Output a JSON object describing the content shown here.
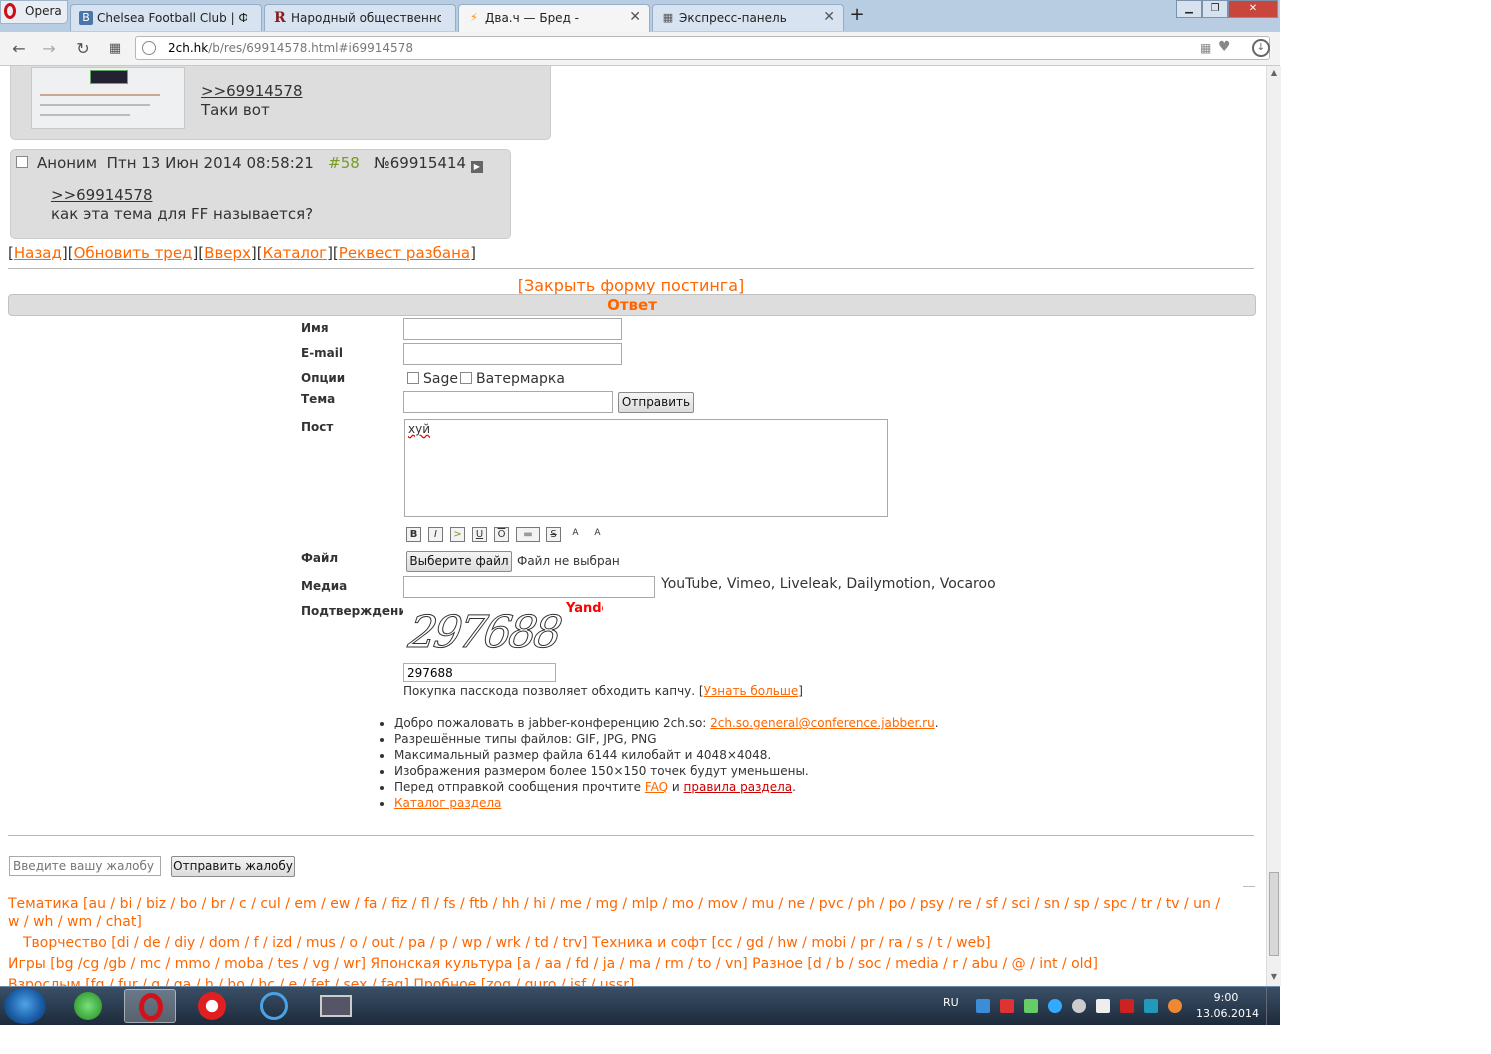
{
  "browser": {
    "opera_label": "Opera",
    "tabs": [
      {
        "title": "Chelsea Football Club | ФК",
        "icon": "B"
      },
      {
        "title": "Народный общественно",
        "icon": "R"
      },
      {
        "title": "Два.ч — Бред -",
        "icon": "⚡"
      },
      {
        "title": "Экспресс-панель",
        "icon": "▦"
      }
    ],
    "new_tab": "+",
    "url_host": "2ch.hk",
    "url_path": "/b/res/69914578.html#i69914578"
  },
  "posts": [
    {
      "reply_link": ">>69914578",
      "text": "Таки вот"
    },
    {
      "author": "Аноним",
      "date": "Птн 13 Июн 2014 08:58:21",
      "index": "#58",
      "number": "№69915414",
      "reply_link": ">>69914578",
      "text": "как эта тема для FF называется?"
    }
  ],
  "thread_nav": {
    "back": "Назад",
    "refresh": "Обновить тред",
    "top": "Вверх",
    "catalog": "Каталог",
    "request": "Реквест разбана"
  },
  "form": {
    "close_label": "[Закрыть форму постинга]",
    "heading": "Ответ",
    "name_label": "Имя",
    "email_label": "E-mail",
    "options_label": "Опции",
    "sage_label": "Sage",
    "watermark_label": "Ватермарка",
    "subject_label": "Тема",
    "send_label": "Отправить",
    "post_label": "Пост",
    "post_value": "хуй",
    "markup_buttons": [
      "B",
      "I",
      ">",
      "U",
      "O",
      "▬",
      "S",
      "A",
      "A"
    ],
    "file_label": "Файл",
    "file_button": "Выберите файл",
    "file_status": "Файл не выбран",
    "media_label": "Медиа",
    "media_hint": "YouTube, Vimeo, Liveleak, Dailymotion, Vocaroo",
    "captcha_label": "Подтверждение",
    "captcha_brand": "Yandex",
    "captcha_digits": "297688",
    "captcha_value": "297688",
    "passcode_text": "Покупка пасскода позволяет обходить капчу. [",
    "passcode_link": "Узнать больше",
    "passcode_close": "]"
  },
  "rules": {
    "r1_text": "Добро пожаловать в jabber-конференцию 2ch.so: ",
    "r1_link": "2ch.so.general@conference.jabber.ru",
    "r1_end": ".",
    "r2": "Разрешённые типы файлов: GIF, JPG, PNG",
    "r3": "Максимальный размер файла 6144 килобайт и 4048×4048.",
    "r4": "Изображения размером более 150×150 точек будут уменьшены.",
    "r5_text": "Перед отправкой сообщения прочтите ",
    "r5_faq": "FAQ",
    "r5_and": " и ",
    "r5_rules": "правила раздела",
    "r5_end": ".",
    "r6": "Каталог раздела"
  },
  "complaint": {
    "placeholder": "Введите вашу жалобу сюда",
    "button": "Отправить жалобу"
  },
  "boards": {
    "line1": "Тематика [au / bi / biz / bo / br / c / cul / em / ew / fa / fiz / fl / fs / ftb / hh / hi / me / mg / mlp / mo / mov / mu / ne / pvc / ph / po / psy / re / sf / sci / sn / sp / spc / tr / tv / un /",
    "line2": "w / wh / wm / chat]",
    "line3": "Творчество [di / de / diy / dom / f / izd / mus / o / out / pa / p / wp / wrk / td / trv]  Техника и софт [cc / gd / hw / mobi / pr / ra / s / t / web]",
    "line4": "Игры [bg /cg /gb / mc / mmo / moba / tes / vg / wr]  Японская культура [a / aa / fd / ja / ma / rm / to / vn]  Разное [d / b / soc / media / r / abu / @ / int / old]",
    "line5": "Взрослым [fg / fur / g / ga / h / ho / hc / e / fet / sex / fag]  Пробное [zog / guro / isf / ussr]"
  },
  "taskbar": {
    "lang": "RU",
    "time": "9:00",
    "date": "13.06.2014"
  },
  "colors": {
    "link": "#ff6600",
    "post_bg": "#dddddd",
    "post_number": "#789922",
    "rules_link_red": "#cc0000"
  }
}
